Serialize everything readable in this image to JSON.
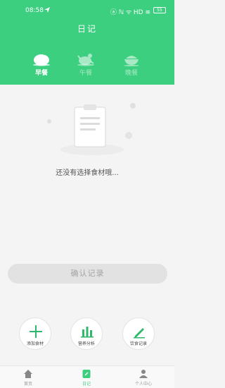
{
  "status_bar": {
    "time": "08:58",
    "indicators": "ⓐ ℕ ᯤ HD ≋",
    "battery": "55"
  },
  "header": {
    "title": "日记"
  },
  "meal_tabs": [
    {
      "label": "早餐",
      "icon": "steamed-bun-icon",
      "active": true
    },
    {
      "label": "午餐",
      "icon": "roast-chicken-icon",
      "active": false
    },
    {
      "label": "晚餐",
      "icon": "rice-bowl-icon",
      "active": false
    }
  ],
  "empty_state": {
    "message": "还没有选择食材哦..."
  },
  "confirm_button": {
    "label": "确认记录"
  },
  "actions": [
    {
      "label": "添加食材",
      "icon": "plus-icon"
    },
    {
      "label": "营养分析",
      "icon": "bar-chart-icon"
    },
    {
      "label": "饮食记录",
      "icon": "pen-icon"
    }
  ],
  "tab_bar": [
    {
      "label": "首页",
      "icon": "home-icon",
      "active": false
    },
    {
      "label": "日记",
      "icon": "diary-icon",
      "active": true
    },
    {
      "label": "个人中心",
      "icon": "user-icon",
      "active": false
    }
  ],
  "colors": {
    "brand_green": "#3ccf7f",
    "background": "#f4f4f4",
    "button_disabled": "#e2e2e2"
  }
}
